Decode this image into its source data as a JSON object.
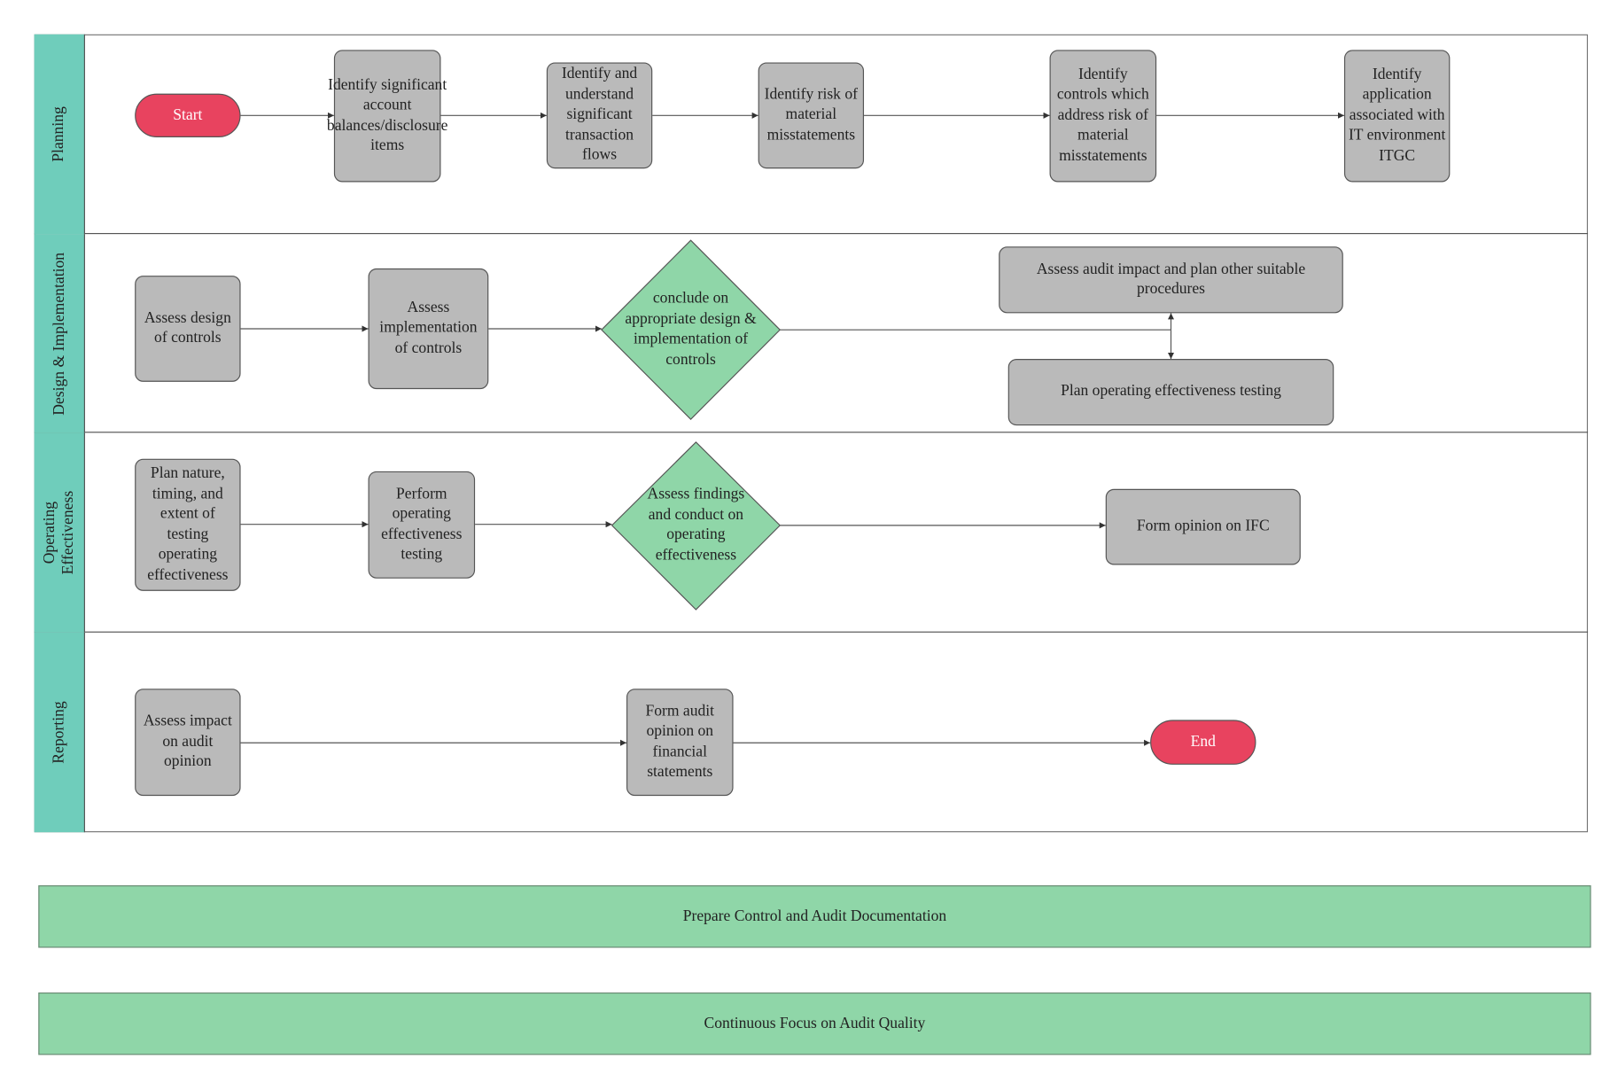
{
  "lanes": [
    "Planning",
    "Design & Implementation",
    "Operating Effectiveness",
    "Reporting"
  ],
  "planning": {
    "start": "Start",
    "steps": [
      "Identify significant account balances/disclosure items",
      "Identify and understand significant transaction flows",
      "Identify risk of material misstatements",
      "Identify controls which address risk of material misstatements",
      "Identify application associated with IT environment ITGC"
    ]
  },
  "design": {
    "steps": [
      "Assess design of controls",
      "Assess implementation of controls"
    ],
    "decision": "conclude on appropriate design & implementation of controls",
    "outcomes": [
      "Assess audit impact and plan other suitable procedures",
      "Plan operating effectiveness testing"
    ]
  },
  "operating": {
    "steps": [
      "Plan nature, timing, and extent of testing operating effectiveness",
      "Perform operating effectiveness testing"
    ],
    "decision": "Assess findings and conduct on operating effectiveness",
    "outcome": "Form opinion on IFC"
  },
  "reporting": {
    "steps": [
      "Assess impact on audit opinion",
      "Form audit opinion on financial statements"
    ],
    "end": "End"
  },
  "bars": [
    "Prepare Control and Audit Documentation",
    "Continuous Focus on Audit Quality"
  ],
  "colors": {
    "lane_header": "#6fcdbb",
    "process": "#bababa",
    "decision": "#8fd6a8",
    "terminal": "#e8435f",
    "bar": "#8fd6a8"
  }
}
